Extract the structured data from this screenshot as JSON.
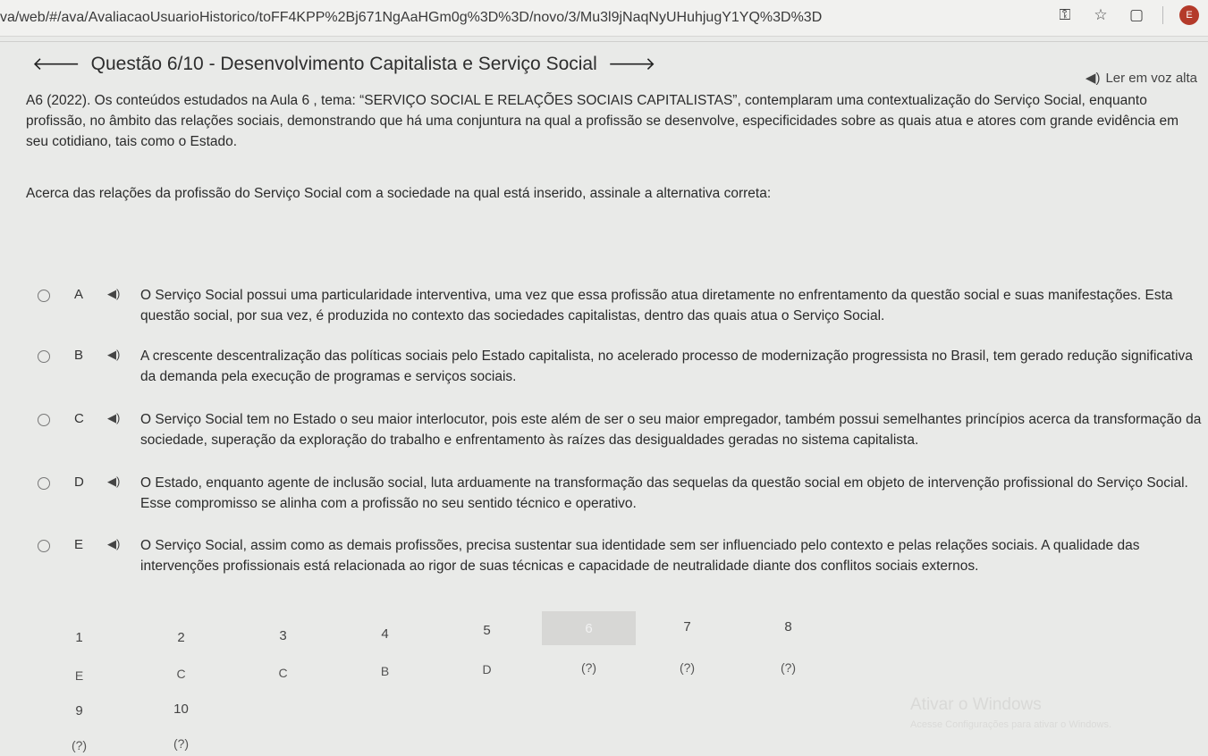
{
  "browser": {
    "url": "va/web/#/ava/AvaliacaoUsuarioHistorico/toFF4KPP%2Bj671NgAaHGm0g%3D%3D/novo/3/Mu3l9jNaqNyUHuhjugY1YQ%3D%3D",
    "profile_initial": "E"
  },
  "question": {
    "title": "Questão 6/10 - Desenvolvimento Capitalista e Serviço Social",
    "read_aloud": "Ler em voz alta",
    "statement": "A6 (2022). Os conteúdos estudados na Aula 6 , tema: “SERVIÇO SOCIAL E RELAÇÕES SOCIAIS CAPITALISTAS”, contemplaram uma contextualização do Serviço Social, enquanto profissão, no âmbito das relações sociais, demonstrando que há uma conjuntura na qual a profissão se desenvolve, especificidades sobre as quais atua e atores com grande evidência em seu cotidiano, tais como o Estado.",
    "prompt": "Acerca das relações da profissão do Serviço Social com a sociedade na qual está inserido, assinale a alternativa correta:"
  },
  "options": [
    {
      "letter": "A",
      "text": "O Serviço Social possui uma particularidade interventiva, uma vez que essa profissão atua diretamente no enfrentamento da questão social e suas manifestações. Esta questão social, por sua vez, é produzida no contexto das sociedades capitalistas, dentro das quais atua o Serviço Social."
    },
    {
      "letter": "B",
      "text": "A crescente descentralização das políticas sociais pelo Estado capitalista, no acelerado processo de modernização progressista no Brasil, tem gerado redução significativa da demanda pela execução de programas e serviços sociais."
    },
    {
      "letter": "C",
      "text": "O Serviço Social tem no Estado o seu maior interlocutor, pois este além de ser o seu maior empregador, também possui semelhantes princípios acerca da transformação da sociedade, superação da exploração do trabalho e enfrentamento às raízes das desigualdades geradas no sistema capitalista."
    },
    {
      "letter": "D",
      "text": "O Estado, enquanto agente de inclusão social, luta arduamente na transformação das sequelas da questão social em objeto de intervenção profissional do Serviço Social. Esse compromisso se alinha com a profissão no seu sentido técnico e operativo."
    },
    {
      "letter": "E",
      "text": "O Serviço Social, assim como as demais profissões, precisa sustentar sua identidade sem ser influenciado pelo contexto e pelas relações sociais. A qualidade das intervenções profissionais está relacionada ao rigor de suas técnicas e capacidade de neutralidade diante dos conflitos sociais externos."
    }
  ],
  "navigation": {
    "row1": [
      {
        "number": "1",
        "answer": "E"
      },
      {
        "number": "2",
        "answer": "C"
      },
      {
        "number": "3",
        "answer": "C"
      },
      {
        "number": "4",
        "answer": "B"
      },
      {
        "number": "5",
        "answer": "D"
      },
      {
        "number": "6",
        "answer": "(?)",
        "active": true
      },
      {
        "number": "7",
        "answer": "(?)"
      },
      {
        "number": "8",
        "answer": "(?)"
      }
    ],
    "row2": [
      {
        "number": "9",
        "answer": "(?)"
      },
      {
        "number": "10",
        "answer": "(?)"
      }
    ]
  },
  "watermark": {
    "title": "Ativar o Windows",
    "subtitle": "Acesse Configurações para ativar o Windows."
  }
}
